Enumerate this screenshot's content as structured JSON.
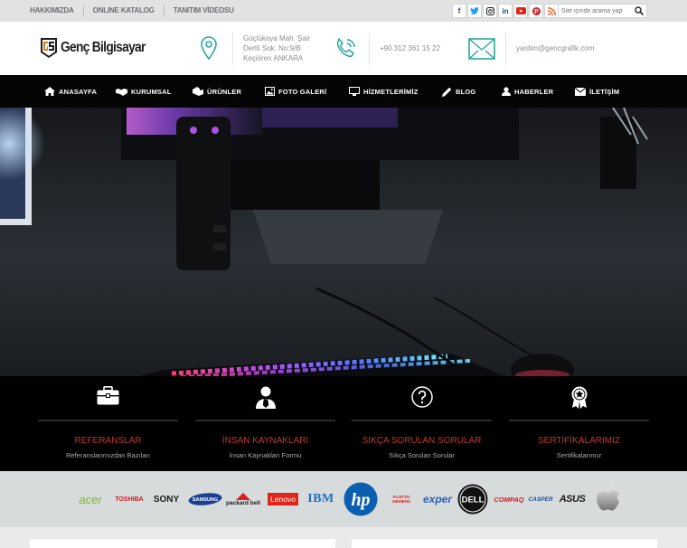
{
  "topbar": {
    "links": [
      "HAKKIMIZDA",
      "ONLINE KATALOG",
      "TANITIM VİDEOSU"
    ],
    "socials": [
      {
        "icon": "facebook-icon",
        "glyph": "f",
        "color": "#3b5998"
      },
      {
        "icon": "twitter-icon",
        "glyph": "t",
        "color": "#1da1f2"
      },
      {
        "icon": "instagram-icon",
        "glyph": "◎",
        "color": "#8a3ab9"
      },
      {
        "icon": "linkedin-icon",
        "glyph": "in",
        "color": "#0e76a8"
      },
      {
        "icon": "youtube-icon",
        "glyph": "▶",
        "color": "#e62117"
      },
      {
        "icon": "pinterest-icon",
        "glyph": "P",
        "color": "#cb2027"
      },
      {
        "icon": "rss-icon",
        "glyph": "◡",
        "color": "#f26522"
      }
    ],
    "search_placeholder": "Site içinde arama yap"
  },
  "header": {
    "logo_text": "Genç Bilgisayar",
    "address": [
      "Güçlükaya Mah. Şair",
      "Dertli Sok. No:9/B",
      "Keçiören ANKARA"
    ],
    "phone": "+90 312 361 15 22",
    "email": "yardim@gencgrafik.com",
    "accent": "#2aa79b"
  },
  "nav": [
    {
      "label": "ANASAYFA",
      "icon": "home-icon"
    },
    {
      "label": "KURUMSAL",
      "icon": "handshake-icon"
    },
    {
      "label": "ÜRÜNLER",
      "icon": "box-icon"
    },
    {
      "label": "FOTO GALERİ",
      "icon": "image-icon"
    },
    {
      "label": "HİZMETLERİMİZ",
      "icon": "monitor-icon"
    },
    {
      "label": "BLOG",
      "icon": "pencil-icon"
    },
    {
      "label": "HABERLER",
      "icon": "user-icon"
    },
    {
      "label": "İLETİŞİM",
      "icon": "envelope-icon"
    }
  ],
  "features": [
    {
      "title": "REFERANSLAR",
      "sub": "Referanslarımızdan Bazıları",
      "icon": "briefcase-icon"
    },
    {
      "title": "İNSAN KAYNAKLARI",
      "sub": "İnsan Kaynakları Formu",
      "icon": "person-tie-icon"
    },
    {
      "title": "SIKÇA SORULAN SORULAR",
      "sub": "Sıkça Sorulan Sorular",
      "icon": "question-icon"
    },
    {
      "title": "SERTİFİKALARIMIZ",
      "sub": "Sertifikalarımız",
      "icon": "award-icon"
    }
  ],
  "brands": [
    "acer",
    "TOSHIBA",
    "SONY",
    "SAMSUNG",
    "packard bell",
    "Lenovo",
    "IBM",
    "hp",
    "FUJITSU SIEMENS",
    "exper",
    "DELL",
    "COMPAQ",
    "CASPER",
    "ASUS",
    "apple"
  ],
  "colors": {
    "feature_title": "#c0392b",
    "nav_bg": "#050505"
  }
}
